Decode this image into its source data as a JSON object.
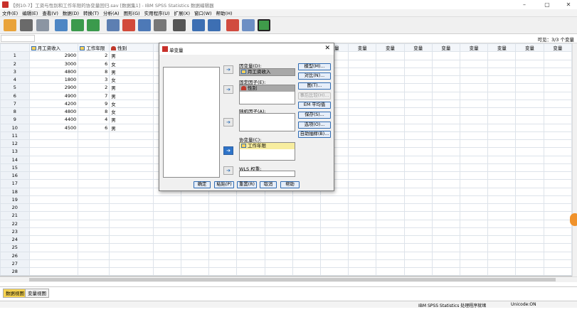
{
  "window": {
    "title": "【例10-7】工资与性别和工作年限的协变量回归.sav [数据集1] - IBM SPSS Statistics 数据编辑器",
    "controls": [
      "–",
      "▢",
      "✕"
    ]
  },
  "menu": [
    "文件(E)",
    "编辑(E)",
    "查看(V)",
    "数据(D)",
    "转换(T)",
    "分析(A)",
    "图形(G)",
    "实用程序(U)",
    "扩展(X)",
    "窗口(W)",
    "帮助(H)"
  ],
  "toolbar_icons": [
    "open-icon",
    "save-icon",
    "print-icon",
    "dialog-recall-icon",
    "undo-icon",
    "redo-icon",
    "goto-case-icon",
    "goto-variable-icon",
    "variables-icon",
    "run-descriptive-icon",
    "find-icon",
    "insert-cases-icon",
    "insert-variable-icon",
    "split-file-icon",
    "weight-cases-icon",
    "select-cases-icon",
    "value-labels-icon"
  ],
  "cellbar": {
    "visible": "可见：3/3 个变量"
  },
  "grid": {
    "columns": [
      {
        "label": "月工资收入",
        "kind": "scale"
      },
      {
        "label": "工作年限",
        "kind": "scale"
      },
      {
        "label": "性别",
        "kind": "nominal"
      },
      {
        "label": "变量"
      },
      {
        "label": "变量"
      },
      {
        "label": "变量"
      },
      {
        "label": "变量"
      },
      {
        "label": "变量"
      },
      {
        "label": "变量"
      },
      {
        "label": "变量"
      },
      {
        "label": "变量"
      },
      {
        "label": "变量"
      },
      {
        "label": "变量"
      },
      {
        "label": "变量"
      },
      {
        "label": "变量"
      },
      {
        "label": "变量"
      },
      {
        "label": "变量"
      },
      {
        "label": "变量"
      }
    ],
    "rows": [
      [
        "1",
        "2900",
        "2",
        "男"
      ],
      [
        "2",
        "3000",
        "6",
        "女"
      ],
      [
        "3",
        "4800",
        "8",
        "男"
      ],
      [
        "4",
        "1800",
        "3",
        "女"
      ],
      [
        "5",
        "2900",
        "2",
        "男"
      ],
      [
        "6",
        "4900",
        "7",
        "男"
      ],
      [
        "7",
        "4200",
        "9",
        "女"
      ],
      [
        "8",
        "4800",
        "8",
        "女"
      ],
      [
        "9",
        "4400",
        "4",
        "男"
      ],
      [
        "10",
        "4500",
        "6",
        "男"
      ],
      [
        "11",
        "",
        "",
        ""
      ],
      [
        "12",
        "",
        "",
        ""
      ],
      [
        "13",
        "",
        "",
        ""
      ],
      [
        "14",
        "",
        "",
        ""
      ],
      [
        "15",
        "",
        "",
        ""
      ],
      [
        "16",
        "",
        "",
        ""
      ],
      [
        "17",
        "",
        "",
        ""
      ],
      [
        "18",
        "",
        "",
        ""
      ],
      [
        "19",
        "",
        "",
        ""
      ],
      [
        "20",
        "",
        "",
        ""
      ],
      [
        "21",
        "",
        "",
        ""
      ],
      [
        "22",
        "",
        "",
        ""
      ],
      [
        "23",
        "",
        "",
        ""
      ],
      [
        "24",
        "",
        "",
        ""
      ],
      [
        "25",
        "",
        "",
        ""
      ],
      [
        "26",
        "",
        "",
        ""
      ],
      [
        "27",
        "",
        "",
        ""
      ],
      [
        "28",
        "",
        "",
        ""
      ]
    ]
  },
  "tabs": {
    "data_view": "数据视图",
    "variable_view": "变量视图"
  },
  "status": {
    "processor": "IBM SPSS Statistics 处理程序就绪",
    "unicode": "Unicode:ON"
  },
  "dialog": {
    "title": "单变量",
    "close": "✕",
    "dependent_label": "因变量(D):",
    "dependent_value": "月工资收入",
    "fixed_label": "固定因子(E):",
    "fixed_items": [
      "性别"
    ],
    "random_label": "随机因子(A):",
    "covariate_label": "协变量(C):",
    "covariate_items": [
      "工作年限"
    ],
    "wls_label": "WLS 权重:",
    "right_buttons": [
      "模型(M)...",
      "对比(N)...",
      "图(T)...",
      "事后比较(H)...",
      "EM 平均值",
      "保存(S)...",
      "选项(O)...",
      "自助抽样(B)..."
    ],
    "bottom_buttons": [
      "确定",
      "粘贴(P)",
      "重置(R)",
      "取消",
      "帮助"
    ]
  }
}
